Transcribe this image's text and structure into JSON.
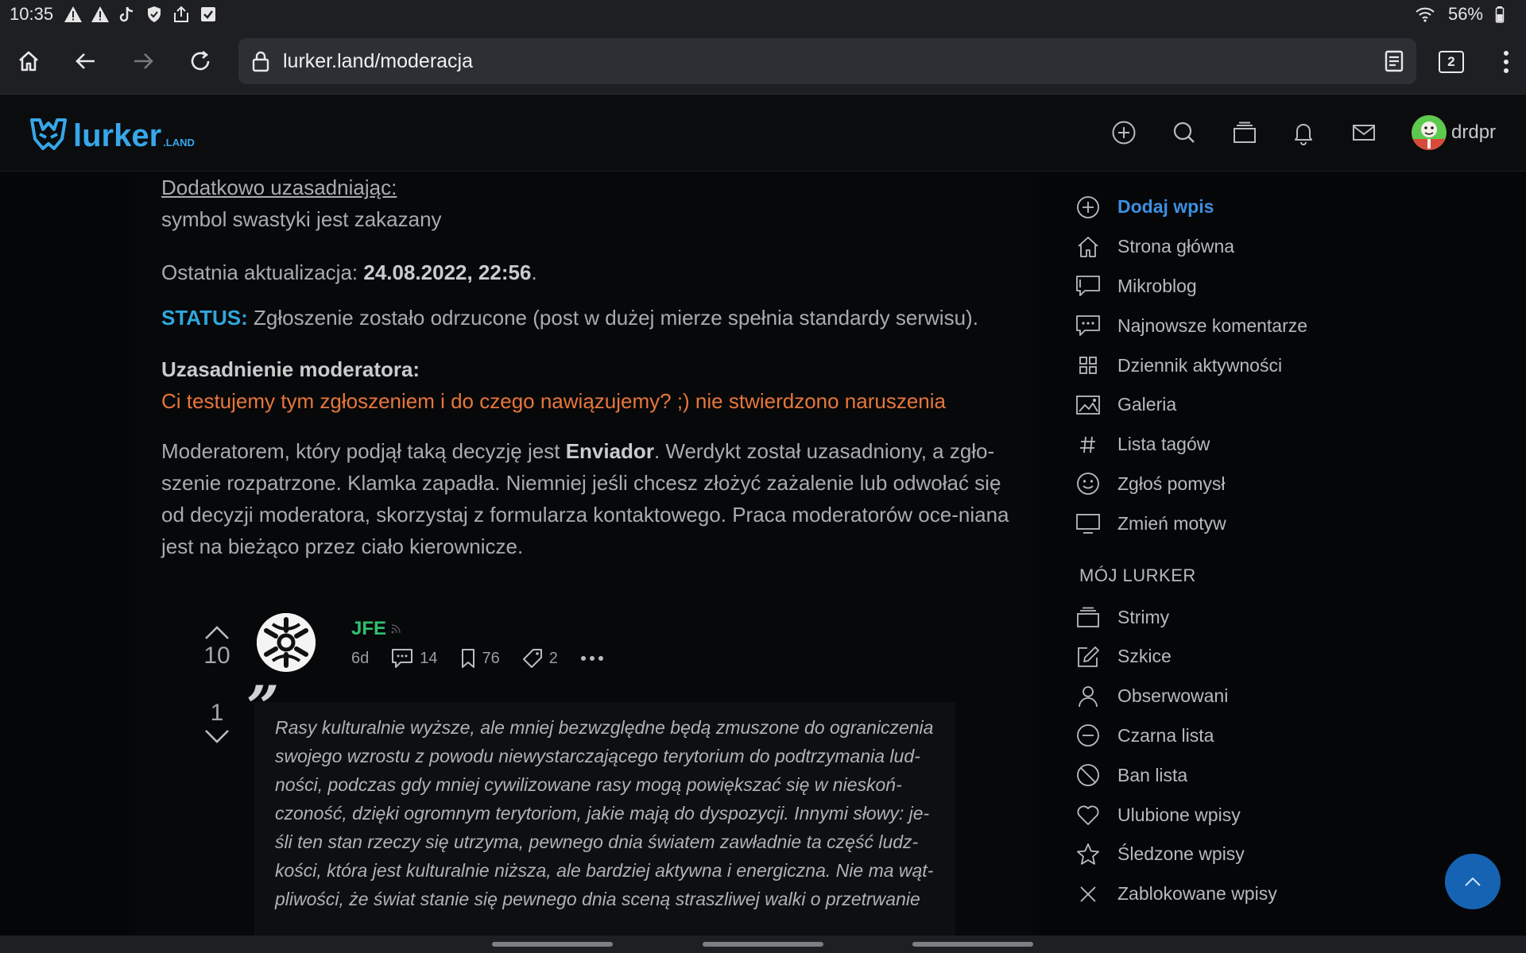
{
  "status": {
    "time": "10:35",
    "battery": "56%",
    "icons": [
      "warning-icon",
      "warning-icon",
      "tiktok-icon",
      "shield-icon",
      "share-icon",
      "checkbox-icon"
    ]
  },
  "browser": {
    "url": "lurker.land/moderacja",
    "tab_count": "2"
  },
  "site": {
    "logo_text": "lurker",
    "logo_suffix": ".LAND",
    "username": "drdpr"
  },
  "article": {
    "extra_label": "Dodatkowo uzasadniając:",
    "extra_text": "symbol swastyki jest zakazany",
    "updated_label": "Ostatnia aktualizacja: ",
    "updated_value": "24.08.2022, 22:56",
    "updated_end": ".",
    "status_label": "STATUS:",
    "status_text": " Zgłoszenie zostało odrzucone (post w dużej mierze spełnia standardy serwisu).",
    "mod_reason_label": "Uzasadnienie moderatora:",
    "mod_reason_text": "Ci testujemy tym zgłoszeniem i do czego nawiązujemy? ;) nie stwierdzono naruszenia",
    "verdict_pre": "Moderatorem, który podjął taką decyzję jest ",
    "moderator": "Enviador",
    "verdict_post": ". Werdykt został uzasadniony, a zgło-szenie rozpatrzone. Klamka zapadła. Niemniej jeśli chcesz złożyć zażalenie lub odwołać się od decyzji moderatora, skorzystaj z formularza kontaktowego. Praca moderatorów oce-niana jest na bieżąco przez ciało kierownicze."
  },
  "post": {
    "upvotes": "10",
    "downvotes": "1",
    "author": "JFE",
    "age": "6d",
    "comments": "14",
    "bookmarks": "76",
    "tags": "2",
    "quote_mark": "”",
    "quote": "Rasy kulturalnie wyższe, ale mniej bezwzględne będą zmuszone do ograniczenia swojego wzrostu z powodu niewystarczającego terytorium do podtrzymania lud-ności, podczas gdy mniej cywilizowane rasy mogą powiększać się w nieskoń-czoność, dzięki ogromnym terytoriom, jakie mają do dyspozycji. Innymi słowy: je-śli ten stan rzeczy się utrzyma, pewnego dnia światem zawładnie ta część ludz-kości, która jest kulturalnie niższa, ale bardziej aktywna i energiczna. Nie ma wąt-pliwości, że świat stanie się pewnego dnia sceną straszliwej walki o przetrwanie"
  },
  "sidebar": {
    "items": [
      {
        "label": "Dodaj wpis",
        "icon": "plus-circle-icon"
      },
      {
        "label": "Strona główna",
        "icon": "home-icon"
      },
      {
        "label": "Mikroblog",
        "icon": "chat-bubble-icon"
      },
      {
        "label": "Najnowsze komentarze",
        "icon": "comment-dots-icon"
      },
      {
        "label": "Dziennik aktywności",
        "icon": "grid-icon"
      },
      {
        "label": "Galeria",
        "icon": "image-icon"
      },
      {
        "label": "Lista tagów",
        "icon": "hash-icon"
      },
      {
        "label": "Zgłoś pomysł",
        "icon": "smile-icon"
      },
      {
        "label": "Zmień motyw",
        "icon": "monitor-icon"
      }
    ],
    "section_title": "MÓJ LURKER",
    "my_items": [
      {
        "label": "Strimy",
        "icon": "layers-icon"
      },
      {
        "label": "Szkice",
        "icon": "edit-icon"
      },
      {
        "label": "Obserwowani",
        "icon": "user-icon"
      },
      {
        "label": "Czarna lista",
        "icon": "minus-circle-icon"
      },
      {
        "label": "Ban lista",
        "icon": "ban-icon"
      },
      {
        "label": "Ulubione wpisy",
        "icon": "heart-icon"
      },
      {
        "label": "Śledzone wpisy",
        "icon": "star-icon"
      },
      {
        "label": "Zablokowane wpisy",
        "icon": "x-icon"
      }
    ]
  },
  "colors": {
    "accent": "#37a7ea",
    "status": "#2fa7dc",
    "orange": "#e8763b",
    "author": "#2fc06f",
    "active": "#3d8fe0"
  }
}
